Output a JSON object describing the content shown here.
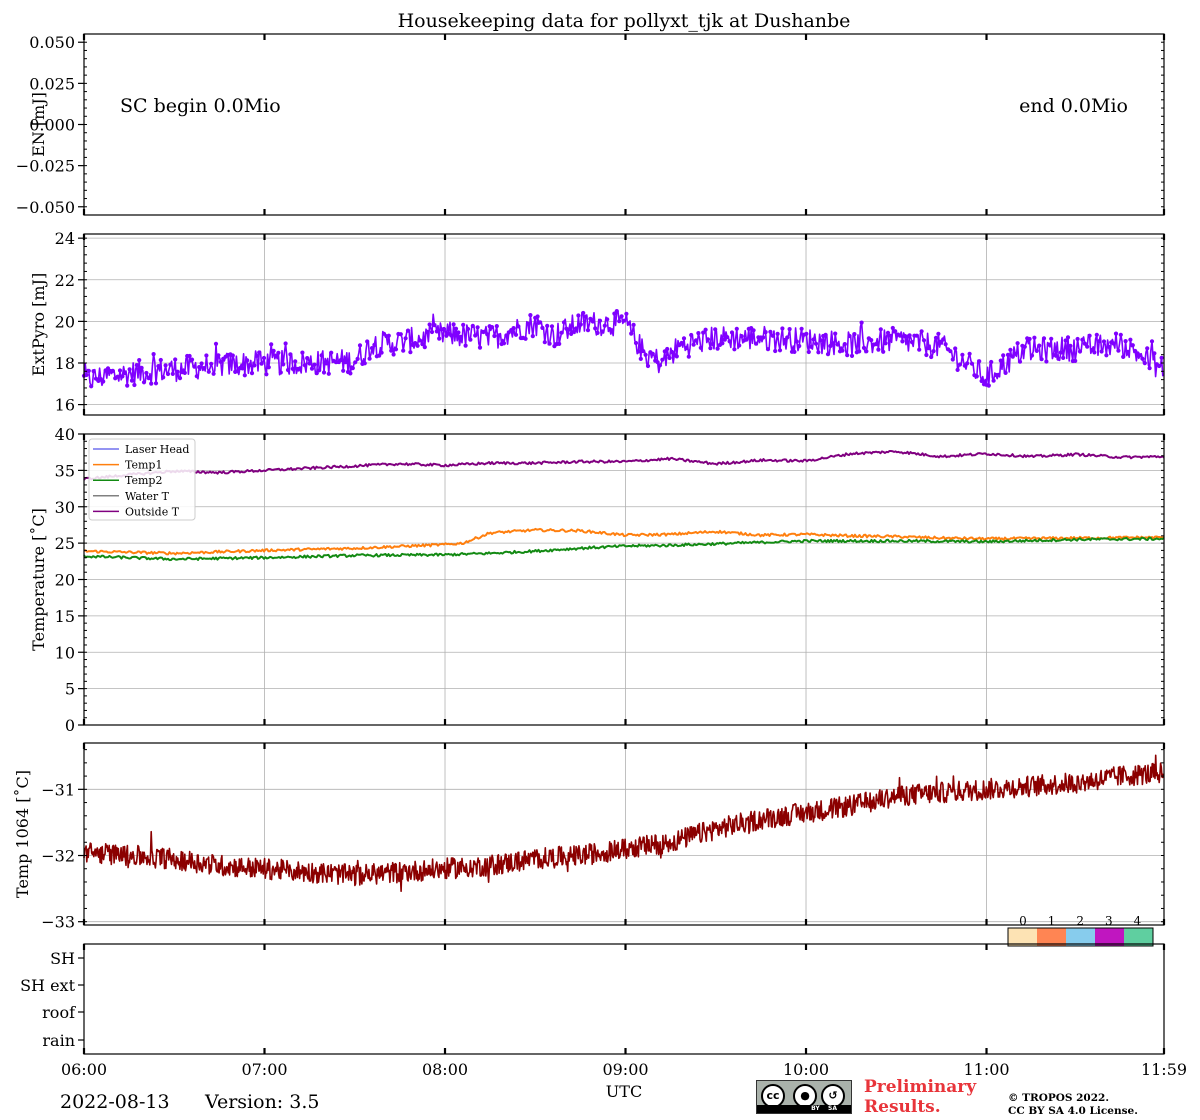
{
  "chart_data": {
    "type": "line",
    "title": "Housekeeping data for pollyxt_tjk at Dushanbe",
    "xlabel": "UTC",
    "x_ticks": [
      "06:00",
      "07:00",
      "08:00",
      "09:00",
      "10:00",
      "11:00",
      "11:59"
    ],
    "x_range_hours": [
      6.0,
      11.9833
    ],
    "panels": [
      {
        "id": "energy",
        "ylabel": "EN [mJ]",
        "ylim": [
          -0.055,
          0.055
        ],
        "yticks": [
          "0.050",
          "0.025",
          "0.000",
          "−0.025",
          "−0.050"
        ],
        "ytick_values": [
          0.05,
          0.025,
          0.0,
          -0.025,
          -0.05
        ],
        "grid": false,
        "annotations": [
          "SC begin 0.0Mio",
          "end 0.0Mio"
        ],
        "series": []
      },
      {
        "id": "extpyro",
        "ylabel": "ExtPyro [mJ]",
        "ylim": [
          15.5,
          24.2
        ],
        "yticks": [
          "24",
          "22",
          "20",
          "18",
          "16"
        ],
        "ytick_values": [
          24,
          22,
          20,
          18,
          16
        ],
        "grid": true,
        "series": [
          {
            "color": "#7f00ff",
            "marker": "dot",
            "x": [
              6.0,
              6.25,
              6.5,
              6.75,
              7.0,
              7.25,
              7.5,
              7.6,
              7.75,
              8.0,
              8.25,
              8.5,
              8.6,
              8.75,
              9.0,
              9.1,
              9.2,
              9.3,
              9.5,
              9.75,
              10.0,
              10.25,
              10.5,
              10.75,
              11.0,
              11.2,
              11.5,
              11.75,
              11.98
            ],
            "values": [
              17.2,
              17.5,
              17.7,
              17.9,
              18.0,
              18.0,
              18.1,
              18.9,
              19.0,
              19.4,
              19.2,
              19.9,
              19.3,
              19.9,
              19.9,
              18.5,
              18.0,
              18.8,
              19.2,
              19.2,
              19.1,
              18.9,
              19.1,
              18.8,
              17.3,
              18.6,
              18.7,
              18.9,
              17.7
            ]
          }
        ]
      },
      {
        "id": "temperature",
        "ylabel": "Temperature [˚C]",
        "ylim": [
          0,
          40
        ],
        "yticks": [
          "40",
          "35",
          "30",
          "25",
          "20",
          "15",
          "10",
          "5",
          "0"
        ],
        "ytick_values": [
          40,
          35,
          30,
          25,
          20,
          15,
          10,
          5,
          0
        ],
        "grid": true,
        "legend_position": "upper-left",
        "series": [
          {
            "name": "Laser Head",
            "color": "#7070ee",
            "x": [],
            "values": []
          },
          {
            "name": "Temp1",
            "color": "#ff7f0e",
            "x": [
              6.0,
              6.5,
              7.0,
              7.5,
              8.0,
              8.1,
              8.25,
              8.5,
              8.75,
              9.0,
              9.25,
              9.5,
              9.75,
              10.0,
              10.25,
              10.5,
              10.75,
              11.0,
              11.5,
              11.98
            ],
            "values": [
              23.9,
              23.6,
              24.0,
              24.3,
              24.8,
              25.0,
              26.4,
              26.8,
              26.7,
              26.1,
              26.2,
              26.6,
              26.1,
              26.2,
              26.0,
              25.9,
              25.7,
              25.6,
              25.7,
              25.8
            ]
          },
          {
            "name": "Temp2",
            "color": "#138a13",
            "x": [
              6.0,
              6.5,
              7.0,
              7.5,
              8.0,
              8.25,
              8.5,
              8.75,
              9.0,
              9.25,
              9.5,
              9.75,
              10.0,
              10.5,
              11.0,
              11.5,
              11.98
            ],
            "values": [
              23.2,
              22.8,
              23.0,
              23.3,
              23.4,
              23.6,
              23.9,
              24.3,
              24.6,
              24.7,
              24.9,
              25.1,
              25.3,
              25.3,
              25.2,
              25.5,
              25.6
            ]
          },
          {
            "name": "Water T",
            "color": "#808080",
            "x": [],
            "values": []
          },
          {
            "name": "Outside T",
            "color": "#800080",
            "x": [
              6.0,
              6.25,
              6.5,
              6.75,
              7.0,
              7.25,
              7.5,
              7.75,
              8.0,
              8.25,
              8.5,
              8.75,
              9.0,
              9.25,
              9.5,
              9.75,
              10.0,
              10.25,
              10.5,
              10.75,
              11.0,
              11.25,
              11.5,
              11.75,
              11.98
            ],
            "values": [
              33.8,
              34.4,
              34.9,
              34.7,
              35.0,
              35.3,
              35.6,
              35.9,
              35.7,
              36.0,
              36.0,
              36.2,
              36.2,
              36.6,
              35.9,
              36.4,
              36.3,
              37.3,
              37.6,
              36.9,
              37.3,
              36.9,
              37.2,
              36.8,
              36.9
            ]
          }
        ]
      },
      {
        "id": "temp1064",
        "ylabel": "Temp 1064 [˚C]",
        "ylim": [
          -33.05,
          -30.3
        ],
        "yticks": [
          "−31",
          "−32",
          "−33"
        ],
        "ytick_values": [
          -31,
          -32,
          -33
        ],
        "grid": true,
        "colorbar_labels": [
          "0",
          "1",
          "2",
          "3",
          "4"
        ],
        "colorbar_colors": [
          "#fde3b4",
          "#ff8553",
          "#87cced",
          "#c016c0",
          "#5fcfa0"
        ],
        "series": [
          {
            "color": "#8b0000",
            "x": [
              6.0,
              6.25,
              6.5,
              6.75,
              7.0,
              7.25,
              7.5,
              7.75,
              8.0,
              8.25,
              8.5,
              8.75,
              9.0,
              9.25,
              9.5,
              9.75,
              10.0,
              10.25,
              10.5,
              10.75,
              11.0,
              11.25,
              11.5,
              11.75,
              11.98
            ],
            "values": [
              -31.95,
              -32.0,
              -32.05,
              -32.15,
              -32.2,
              -32.25,
              -32.3,
              -32.25,
              -32.2,
              -32.15,
              -32.05,
              -32.0,
              -31.9,
              -31.8,
              -31.6,
              -31.45,
              -31.35,
              -31.25,
              -31.1,
              -31.05,
              -31.0,
              -30.95,
              -30.9,
              -30.8,
              -30.75
            ]
          }
        ]
      },
      {
        "id": "status",
        "ylabel": "",
        "categories": [
          "SH",
          "SH ext",
          "roof",
          "rain"
        ],
        "series": []
      }
    ]
  },
  "footer": {
    "date": "2022-08-13",
    "version": "Version: 3.5",
    "preliminary_line1": "Preliminary",
    "preliminary_line2": "Results.",
    "copyright_line1": "© TROPOS 2022.",
    "copyright_line2": "CC BY SA 4.0 License.",
    "cc_badge_labels": [
      "cc",
      "BY",
      "SA"
    ]
  }
}
